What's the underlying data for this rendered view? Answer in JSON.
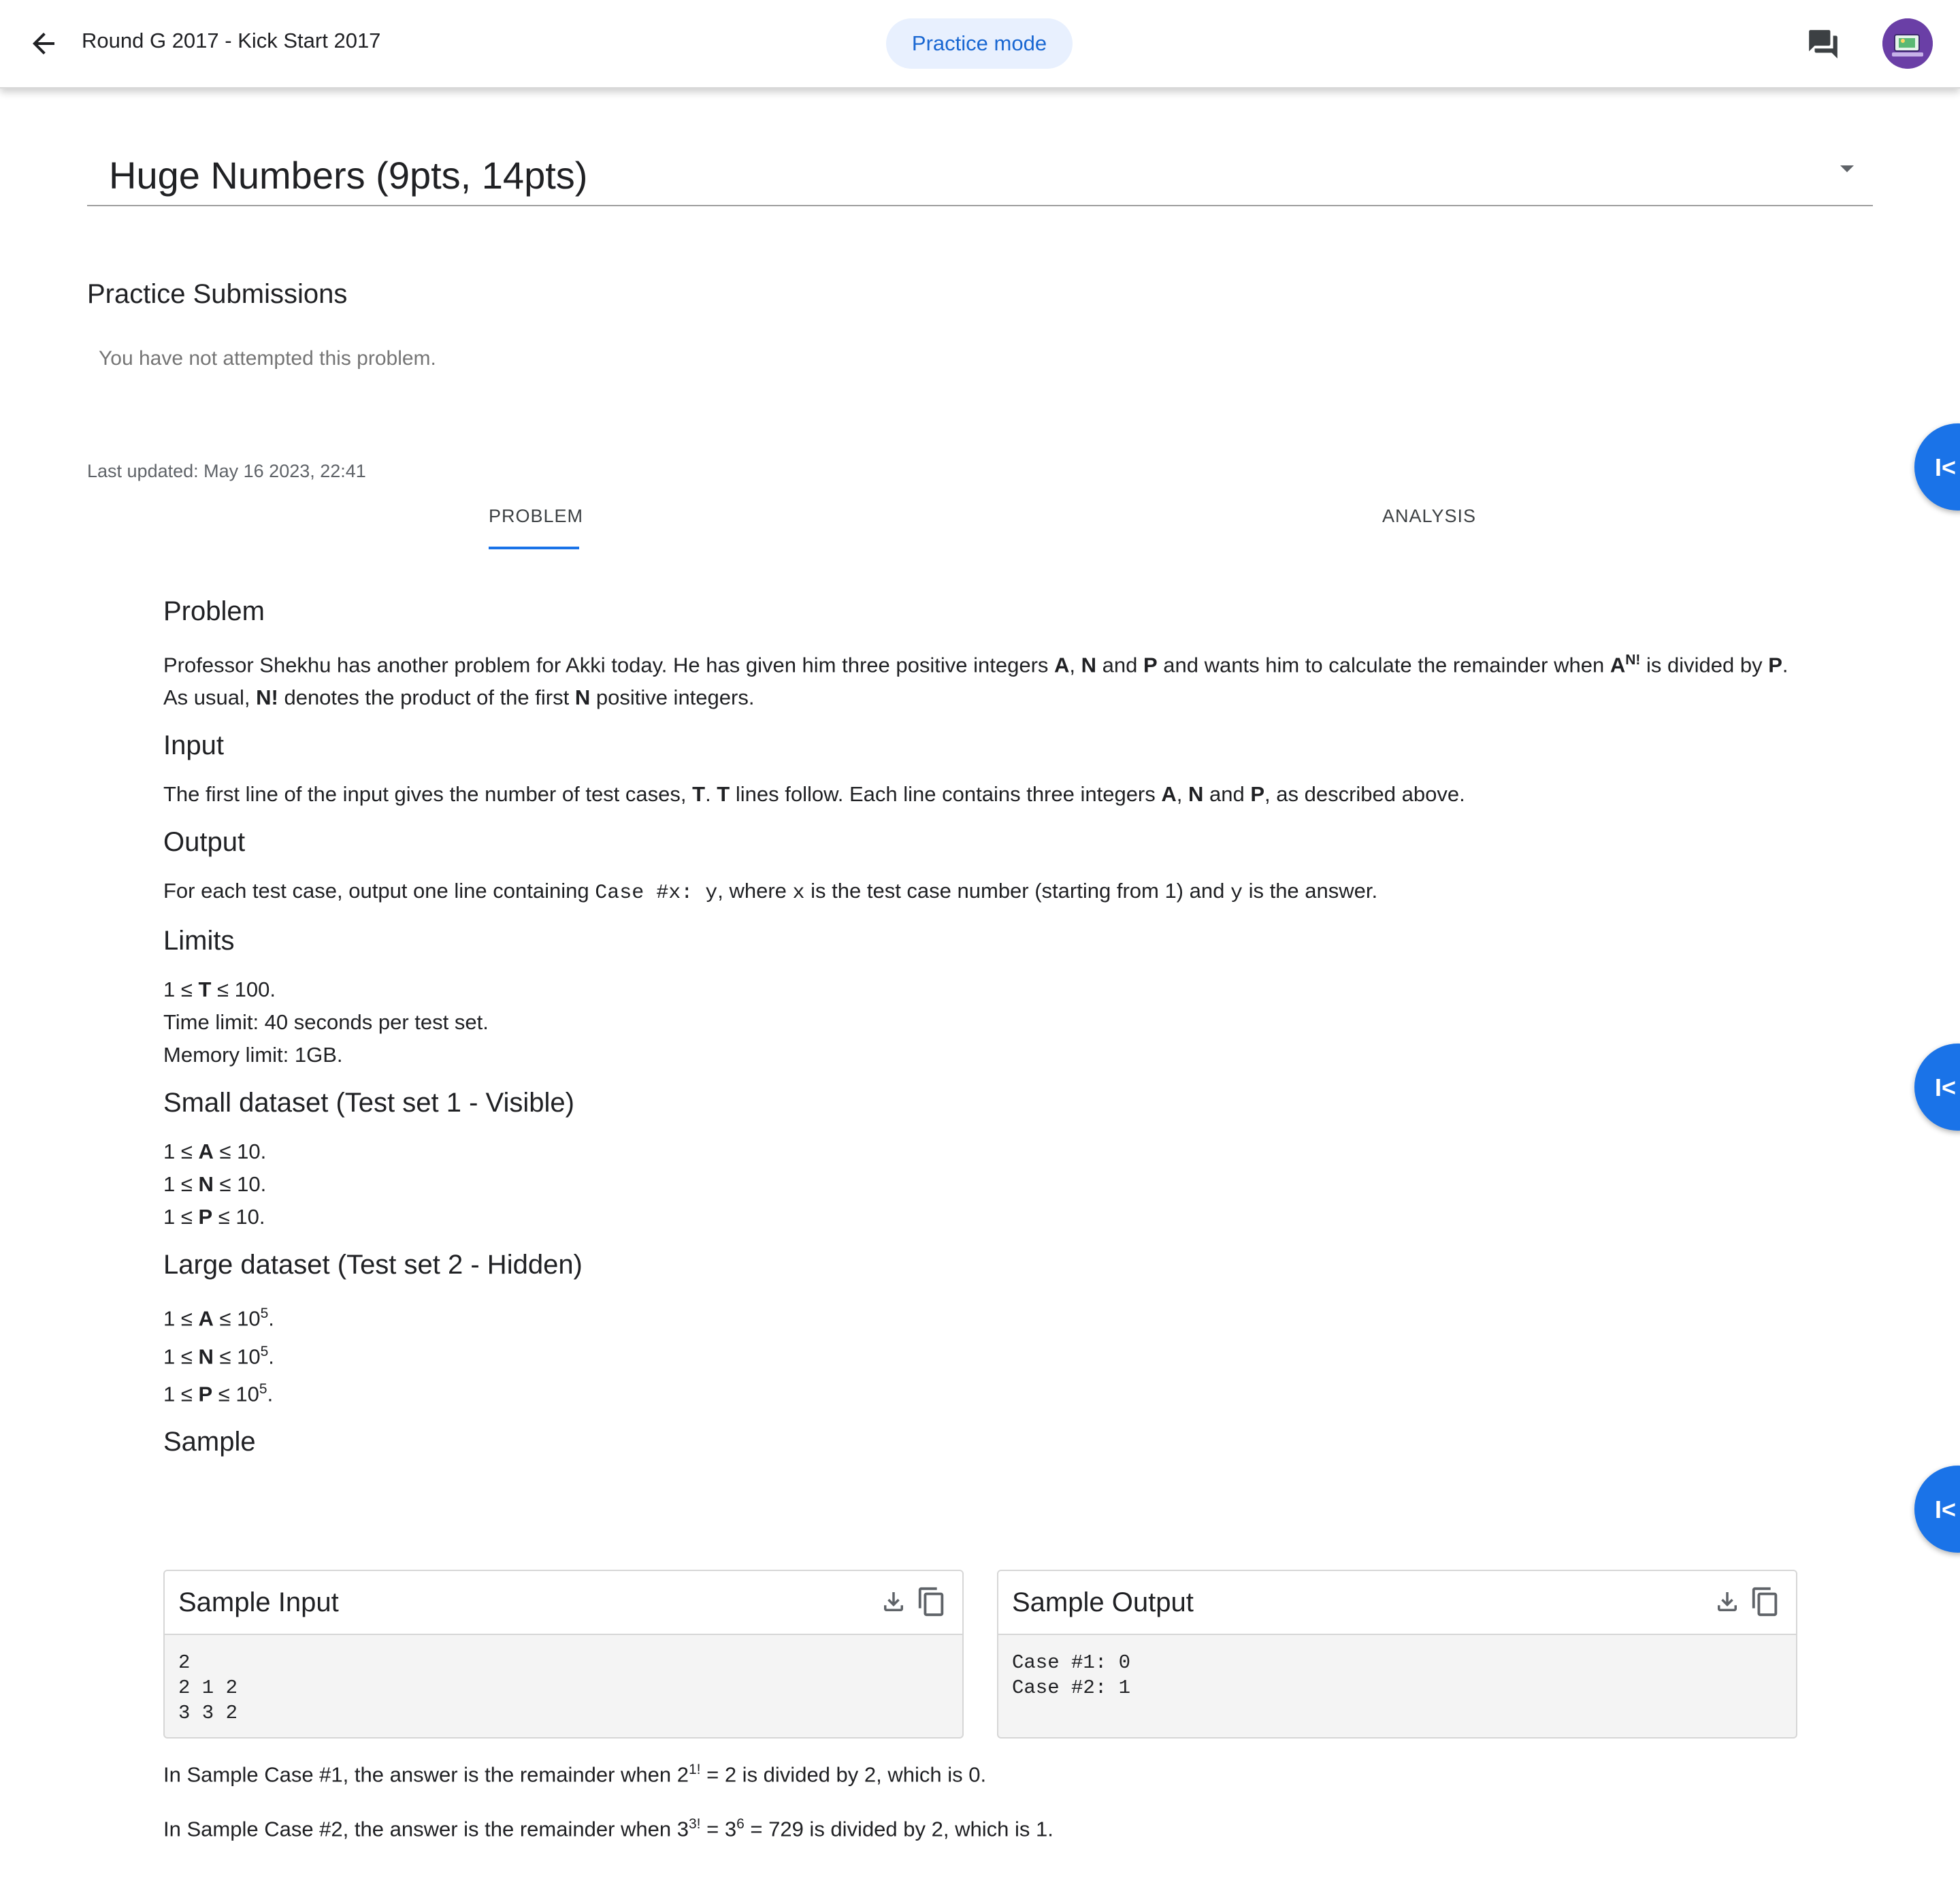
{
  "header": {
    "round_title": "Round G 2017 - Kick Start 2017",
    "mode_label": "Practice mode"
  },
  "problem_select": {
    "title": "Huge Numbers (9pts, 14pts)"
  },
  "submissions": {
    "heading": "Practice Submissions",
    "empty_text": "You have not attempted this problem."
  },
  "last_updated": "Last updated: May 16 2023, 22:41",
  "tabs": [
    {
      "label": "PROBLEM",
      "active": true
    },
    {
      "label": "ANALYSIS",
      "active": false
    }
  ],
  "fab": {
    "glyph": "I<"
  },
  "statement": {
    "problem_heading": "Problem",
    "problem_1": "Professor Shekhu has another problem for Akki today. He has given him three positive integers ",
    "var_a": "A",
    "comma": ", ",
    "var_n": "N",
    "and": " and ",
    "var_p": "P",
    "problem_2": " and wants him to calculate the remainder when ",
    "sup_nfact": "N!",
    "problem_3": " is divided by ",
    "problem_4": ". As usual, ",
    "nfact": "N!",
    "problem_5": " denotes the product of the first ",
    "problem_6": " positive integers.",
    "input_heading": "Input",
    "input_1": "The first line of the input gives the number of test cases, ",
    "var_t": "T",
    "input_2": ". ",
    "input_3": " lines follow. Each line contains three integers ",
    "input_4": ", as described above.",
    "output_heading": "Output",
    "output_1": "For each test case, output one line containing ",
    "output_code": "Case #x: y",
    "output_2": ", where ",
    "code_x": "x",
    "output_3": " is the test case number (starting from 1) and ",
    "code_y": "y",
    "output_4": " is the answer.",
    "limits_heading": "Limits",
    "limit_t_pre": "1 ≤ ",
    "limit_t_post": " ≤ 100.",
    "time_limit": "Time limit: 40 seconds per test set.",
    "memory_limit": "Memory limit: 1GB.",
    "small_heading": "Small dataset (Test set 1 - Visible)",
    "small_pre": "1 ≤ ",
    "small_post": " ≤ 10.",
    "large_heading": "Large dataset (Test set 2 - Hidden)",
    "large_pre": "1 ≤ ",
    "large_mid": " ≤ 10",
    "large_exp": "5",
    "large_end": ".",
    "sample_heading": "Sample"
  },
  "samples": {
    "input_label": "Sample Input",
    "input_text": "2\n2 1 2\n3 3 2",
    "output_label": "Sample Output",
    "output_text": "Case #1: 0\nCase #2: 1"
  },
  "explanations": {
    "case1_pre": "In Sample Case #1, the answer is the remainder when 2",
    "case1_sup": "1!",
    "case1_post": " = 2 is divided by 2, which is 0.",
    "case2_pre": "In Sample Case #2, the answer is the remainder when 3",
    "case2_sup": "3!",
    "case2_mid": " = 3",
    "case2_sup2": "6",
    "case2_post": " = 729 is divided by 2, which is 1."
  }
}
